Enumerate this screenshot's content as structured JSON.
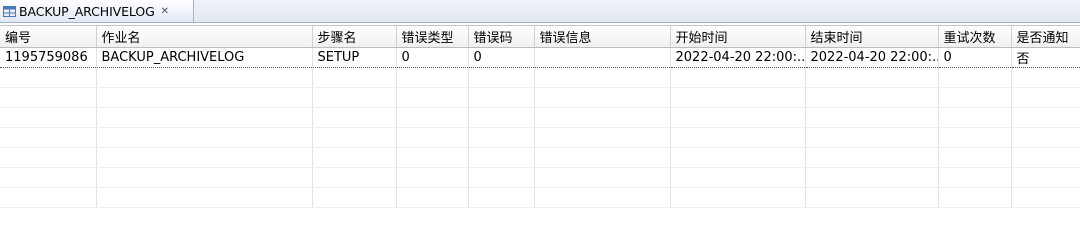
{
  "tab": {
    "title": "BACKUP_ARCHIVELOG",
    "close_glyph": "✕",
    "icon": "table-icon"
  },
  "table": {
    "columns": [
      "编号",
      "作业名",
      "步骤名",
      "错误类型",
      "错误码",
      "错误信息",
      "开始时间",
      "结束时间",
      "重试次数",
      "是否通知"
    ],
    "rows": [
      [
        "1195759086",
        "BACKUP_ARCHIVELOG",
        "SETUP",
        "0",
        "0",
        "",
        "2022-04-20 22:00:...",
        "2022-04-20 22:00:...",
        "0",
        "否"
      ]
    ],
    "empty_rows": 7
  }
}
